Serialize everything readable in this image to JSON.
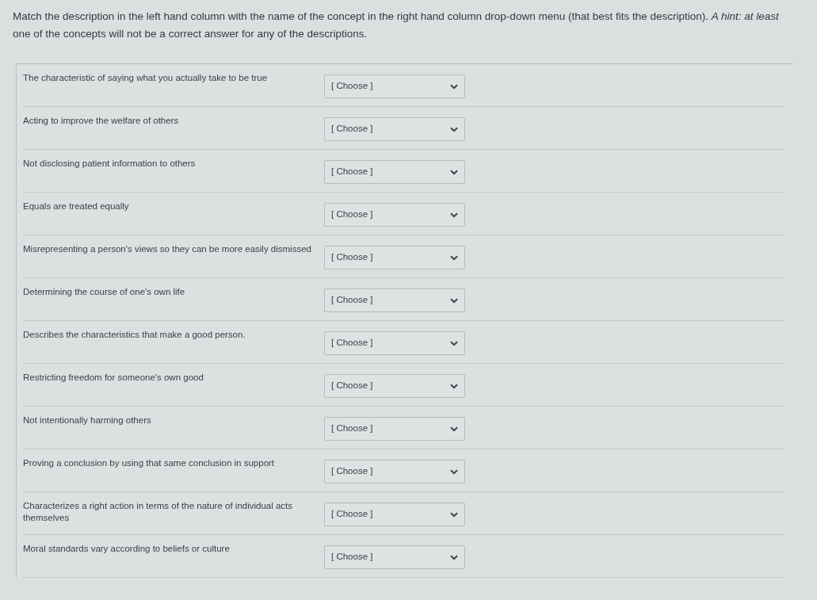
{
  "instructions": "Match the description in the left hand column with the name of the concept in the right hand column drop-down menu (that best fits the description).  *A hint: at least* one of the concepts will not be a correct answer for any of the descriptions.",
  "rows": [
    {
      "description": "The characteristic of saying what you actually take to be true",
      "answer": "[ Choose ]"
    },
    {
      "description": "Acting to improve the welfare of others",
      "answer": "[ Choose ]"
    },
    {
      "description": "Not disclosing patient information to others",
      "answer": "[ Choose ]"
    },
    {
      "description": "Equals are treated equally",
      "answer": "[ Choose ]"
    },
    {
      "description": "Misrepresenting a person's views so they can be more easily dismissed",
      "answer": "[ Choose ]"
    },
    {
      "description": "Determining the course of one's own life",
      "answer": "[ Choose ]"
    },
    {
      "description": "Describes the characteristics that make a good person.",
      "answer": "[ Choose ]"
    },
    {
      "description": "Restricting freedom for someone's own good",
      "answer": "[ Choose ]"
    },
    {
      "description": "Not intentionally harming others",
      "answer": "[ Choose ]"
    },
    {
      "description": "Proving a conclusion by using that same conclusion in support",
      "answer": "[ Choose ]"
    },
    {
      "description": "Characterizes a right action in terms of the nature of individual acts themselves",
      "answer": "[ Choose ]"
    },
    {
      "description": "Moral standards vary according to beliefs or culture",
      "answer": "[ Choose ]"
    }
  ]
}
